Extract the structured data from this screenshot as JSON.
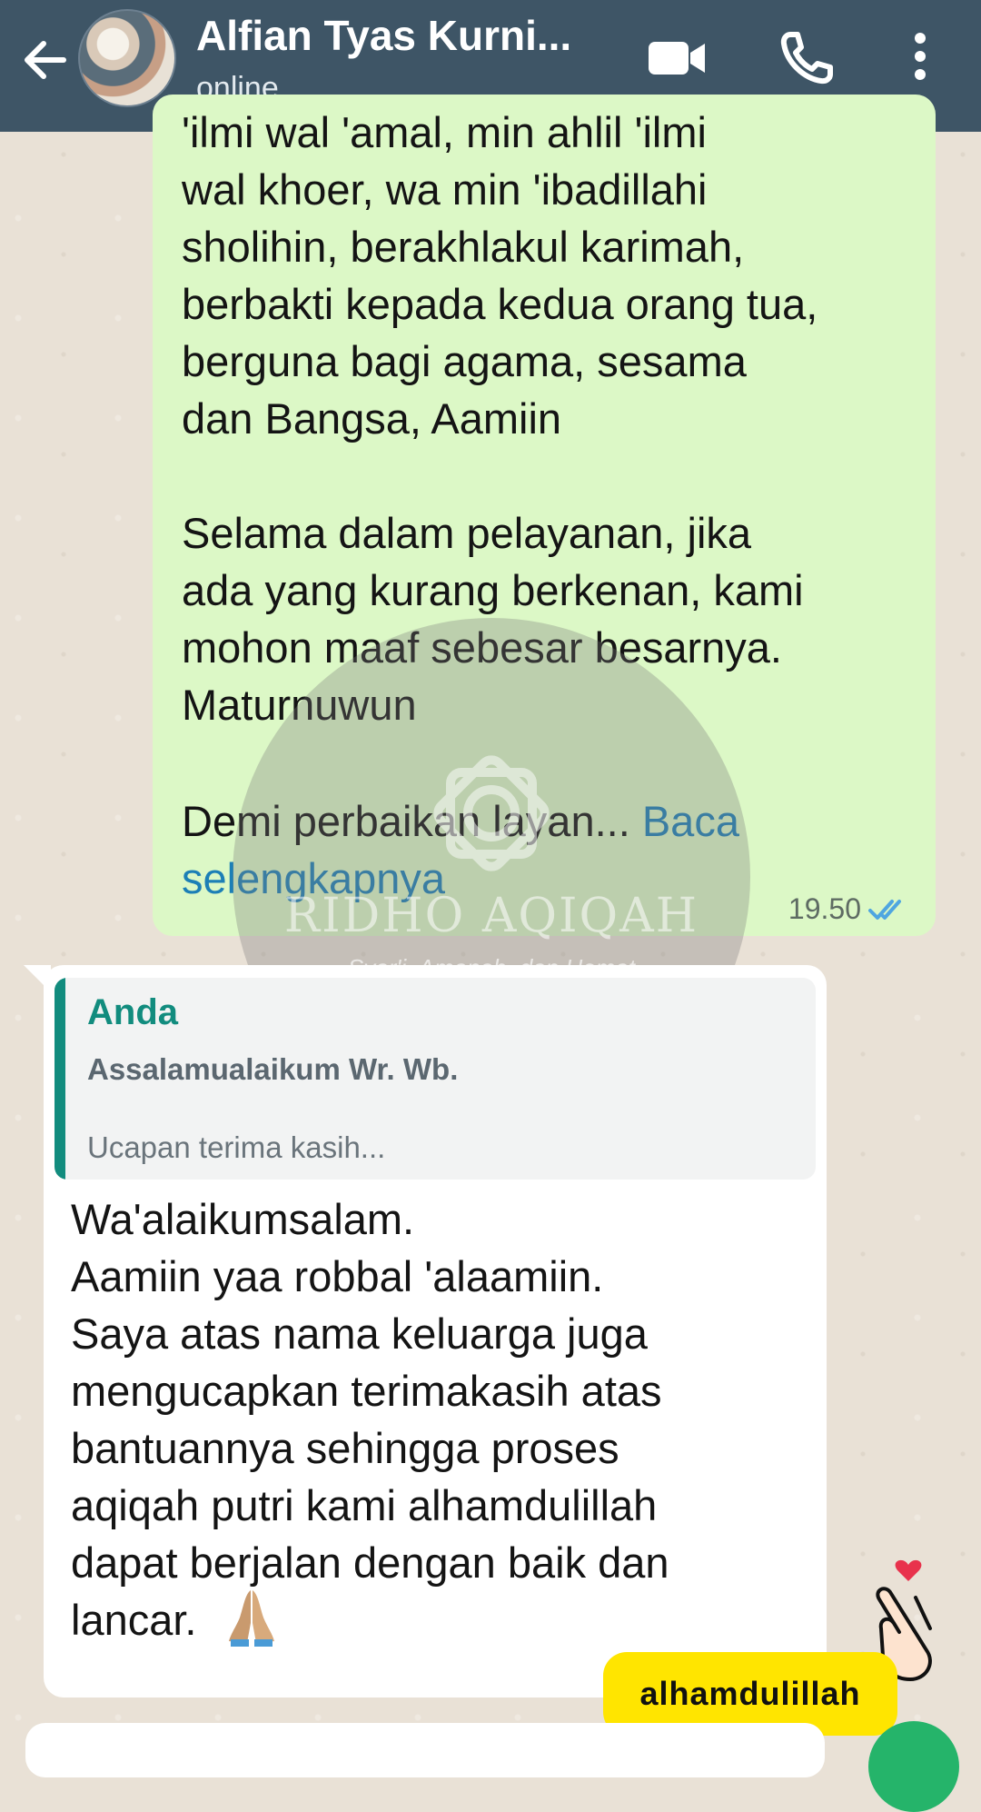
{
  "header": {
    "contact_name": "Alfian Tyas Kurni...",
    "status": "online",
    "colors": {
      "bar": "#3e5566"
    }
  },
  "outgoing_message": {
    "text": "'ilmi wal 'amal, min ahlil 'ilmi\nwal khoer, wa min 'ibadillahi\nsholihin, berakhlakul karimah,\nberbakti kepada kedua orang tua,\nberguna bagi agama, sesama\ndan Bangsa, Aamiin\n\nSelama dalam pelayanan, jika\nada yang kurang berkenan, kami\nmohon maaf sebesar besarnya.\nMaturnuwun\n",
    "truncated_text": "Demi perbaikan layan...",
    "read_more_label": "Baca selengkapnya",
    "time": "19.50",
    "status_icon": "double-check-read-icon"
  },
  "watermark": {
    "title": "RIDHO AQIQAH",
    "subtitle": "Syar'i, Amanah, dan Hemat"
  },
  "incoming_message": {
    "quote": {
      "author": "Anda",
      "line1": "Assalamualaikum Wr. Wb.",
      "line2": "Ucapan terima kasih..."
    },
    "text": "Wa'alaikumsalam.\nAamiin yaa robbal 'alaamiin.\nSaya atas nama keluarga juga\nmengucapkan terimakasih atas\nbantuannya sehingga proses\naqiqah putri kami alhamdulillah\ndapat berjalan dengan baik dan\nlancar.",
    "emoji": "folded-hands-emoji"
  },
  "sticker": {
    "label": "alhamdulillah",
    "icon": "finger-heart-icon"
  }
}
